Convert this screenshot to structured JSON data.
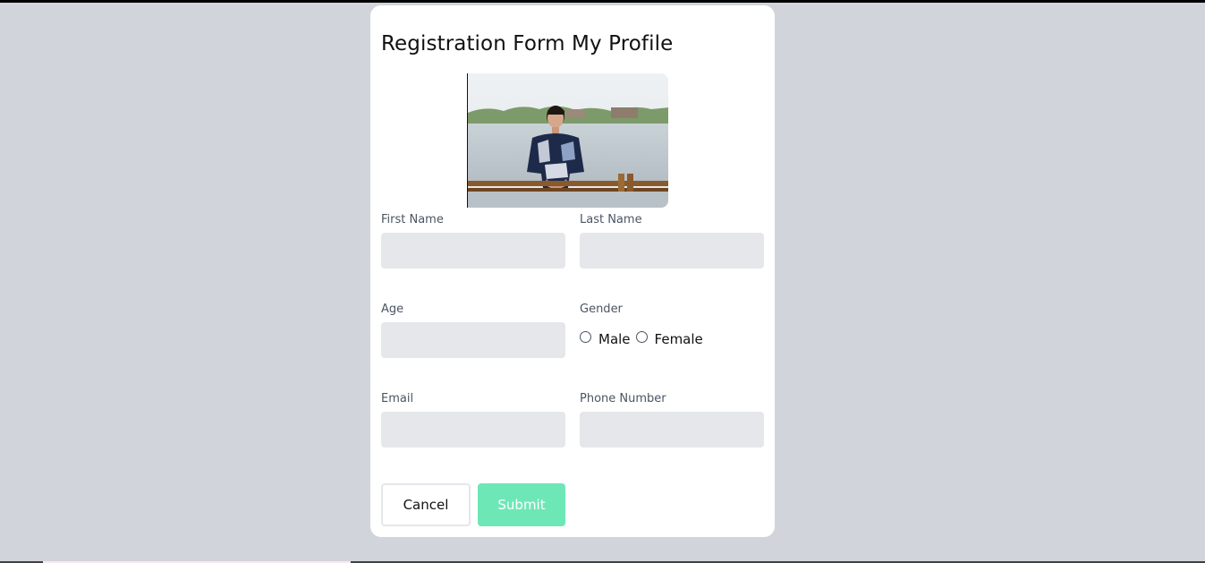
{
  "form": {
    "title": "Registration Form My Profile",
    "first_name": {
      "label": "First Name",
      "value": ""
    },
    "last_name": {
      "label": "Last Name",
      "value": ""
    },
    "age": {
      "label": "Age",
      "value": ""
    },
    "gender": {
      "label": "Gender",
      "options": [
        "Male",
        "Female"
      ],
      "selected": null
    },
    "email": {
      "label": "Email",
      "value": ""
    },
    "phone": {
      "label": "Phone Number",
      "value": ""
    },
    "cancel_label": "Cancel",
    "submit_label": "Submit"
  },
  "colors": {
    "page_background": "#d1d5db",
    "card_background": "#ffffff",
    "input_background": "#e5e7eb",
    "submit_background": "#6ee7b7"
  }
}
